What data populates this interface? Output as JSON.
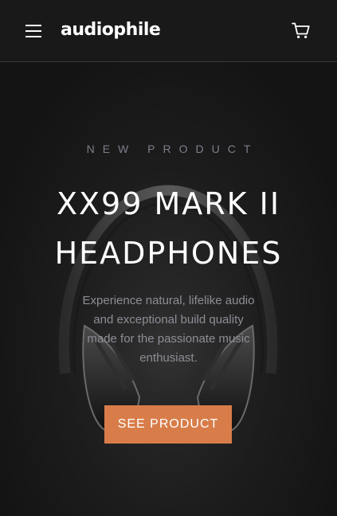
{
  "header": {
    "logo": "audiophile",
    "menu_icon": "hamburger-menu-icon",
    "cart_icon": "shopping-cart-icon"
  },
  "hero": {
    "overline": "NEW PRODUCT",
    "title_line1": "XX99 MARK II",
    "title_line2": "HEADPHONES",
    "description": "Experience natural, lifelike audio and exceptional build quality made for the passionate music enthusiast.",
    "cta_label": "SEE PRODUCT",
    "background_image": "headphones-image"
  },
  "colors": {
    "background": "#141414",
    "header": "#191919",
    "accent": "#d87d4a",
    "overline": "#7d7d8a",
    "body_text": "#8d8d96"
  }
}
